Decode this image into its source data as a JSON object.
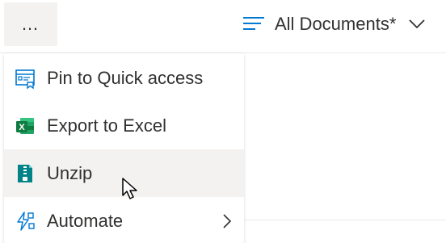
{
  "toolbar": {
    "more_button_label": "…",
    "more_button_icon": "more-horizontal-icon",
    "view_icon": "view-list-icon",
    "view_label": "All Documents*",
    "view_chevron_icon": "chevron-down-icon"
  },
  "menu": {
    "items": [
      {
        "label": "Pin to Quick access",
        "icon": "pin-to-quick-access-icon",
        "state": "normal"
      },
      {
        "label": "Export to Excel",
        "icon": "excel-icon",
        "state": "normal"
      },
      {
        "label": "Unzip",
        "icon": "zip-file-icon",
        "state": "hovered"
      },
      {
        "label": "Automate",
        "icon": "automate-icon",
        "state": "normal",
        "has_submenu": true
      }
    ]
  },
  "colors": {
    "accent": "#0078d4",
    "text": "#323130",
    "hover": "#f3f2f1",
    "excel": "#107c41",
    "zip": "#038387",
    "divider": "#edebe9"
  }
}
